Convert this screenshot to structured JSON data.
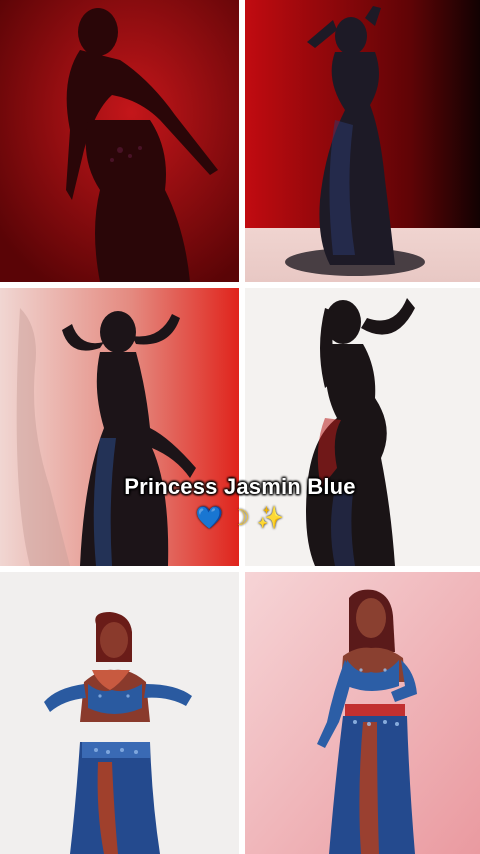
{
  "caption": {
    "title": "Princess Jasmin Blue",
    "emoji_heart": "💙",
    "emoji_moon": "☽",
    "emoji_sparkles": "✨"
  },
  "photos": [
    {
      "description_icon": "dancer-silhouette",
      "background": "#a80c10"
    },
    {
      "description_icon": "dancer-silhouette",
      "background": "#b0080c"
    },
    {
      "description_icon": "dancer-silhouette",
      "background": "#d83a34"
    },
    {
      "description_icon": "dancer-silhouette",
      "background": "#f3f1ef"
    },
    {
      "description_icon": "dancer-full-light",
      "background": "#f1efee"
    },
    {
      "description_icon": "dancer-full-light",
      "background": "#f2c4c8"
    }
  ]
}
